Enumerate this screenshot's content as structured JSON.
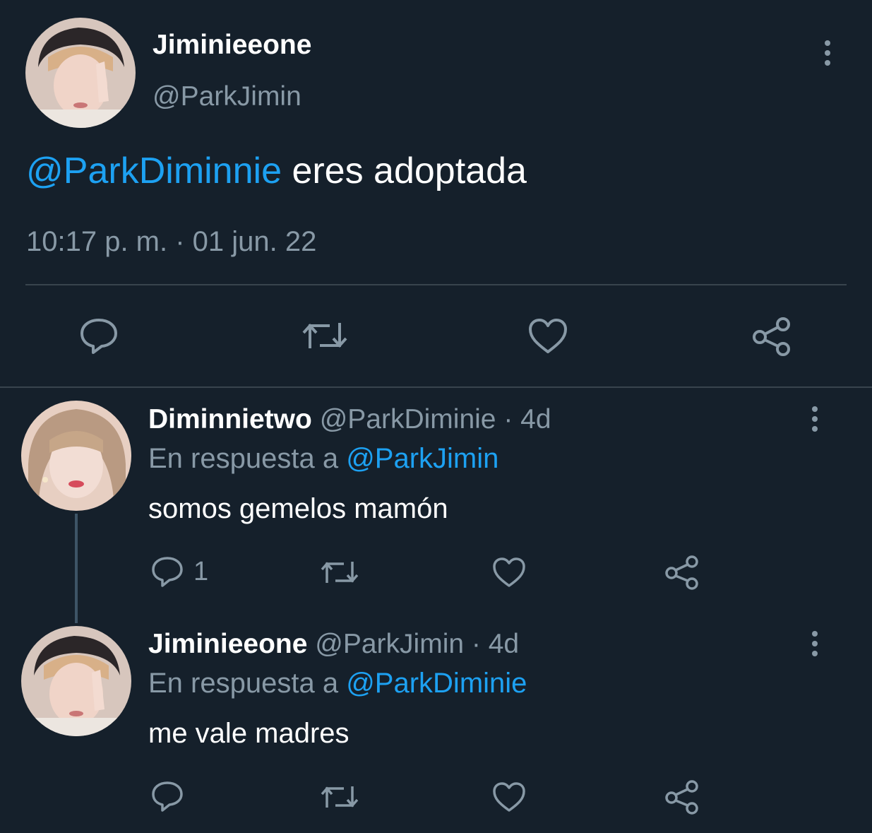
{
  "main_tweet": {
    "display_name": "Jiminieeone",
    "handle": "@ParkJimin",
    "mention": "@ParkDiminnie",
    "text": " eres adoptada",
    "timestamp": "10:17 p. m. · 01 jun. 22",
    "actions": [
      "reply-icon",
      "retweet-icon",
      "like-icon",
      "share-icon"
    ]
  },
  "replies": [
    {
      "display_name": "Diminnietwo",
      "handle_time": "@ParkDiminie · 4d",
      "reply_prefix": "En respuesta a ",
      "reply_to": "@ParkJimin",
      "text": "somos gemelos mamón",
      "reply_count": "1"
    },
    {
      "display_name": "Jiminieeone",
      "handle_time": "@ParkJimin · 4d",
      "reply_prefix": "En respuesta a ",
      "reply_to": "@ParkDiminie",
      "text": "me vale madres",
      "reply_count": ""
    }
  ],
  "colors": {
    "background": "#15202b",
    "text": "#ffffff",
    "muted": "#8899a6",
    "link": "#1da1f2",
    "divider": "#38444d"
  }
}
